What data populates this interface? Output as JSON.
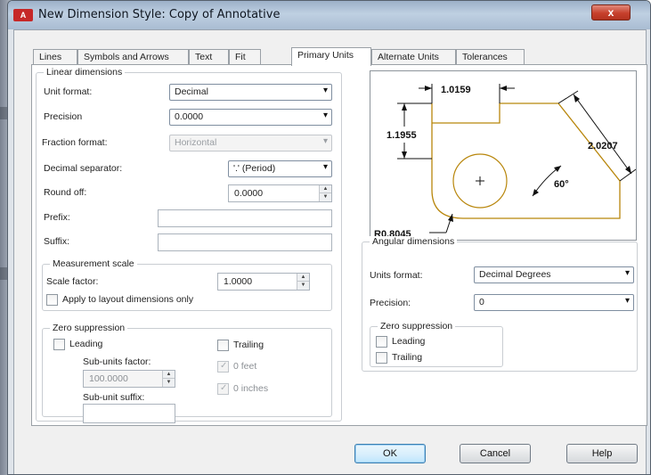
{
  "window": {
    "app_icon": "A",
    "title": "New Dimension Style: Copy of Annotative",
    "close_label": "x"
  },
  "tabs": [
    {
      "label": "Lines",
      "active": false
    },
    {
      "label": "Symbols and Arrows",
      "active": false
    },
    {
      "label": "Text",
      "active": false
    },
    {
      "label": "Fit",
      "active": false
    },
    {
      "label": "Primary Units",
      "active": true
    },
    {
      "label": "Alternate Units",
      "active": false
    },
    {
      "label": "Tolerances",
      "active": false
    }
  ],
  "linear": {
    "legend": "Linear dimensions",
    "unit_format": {
      "label": "Unit format:",
      "value": "Decimal"
    },
    "precision": {
      "label": "Precision",
      "value": "0.0000"
    },
    "fraction_format": {
      "label": "Fraction format:",
      "value": "Horizontal"
    },
    "decimal_separator": {
      "label": "Decimal separator:",
      "value": "'.' (Period)"
    },
    "round_off": {
      "label": "Round off:",
      "value": "0.0000"
    },
    "prefix": {
      "label": "Prefix:",
      "value": ""
    },
    "suffix": {
      "label": "Suffix:",
      "value": ""
    }
  },
  "measurement": {
    "legend": "Measurement scale",
    "scale_factor": {
      "label": "Scale factor:",
      "value": "1.0000"
    },
    "apply_layout": "Apply to layout dimensions only"
  },
  "zero_linear": {
    "legend": "Zero suppression",
    "leading": "Leading",
    "trailing": "Trailing",
    "sub_units_factor": {
      "label": "Sub-units factor:",
      "value": "100.0000"
    },
    "sub_unit_suffix": {
      "label": "Sub-unit suffix:",
      "value": ""
    },
    "zero_feet": "0 feet",
    "zero_inches": "0 inches"
  },
  "preview": {
    "dim_top": "1.0159",
    "dim_left": "1.1955",
    "dim_right": "2.0207",
    "angle": "60°",
    "radius": "R0.8045"
  },
  "angular": {
    "legend": "Angular dimensions",
    "units_format": {
      "label": "Units format:",
      "value": "Decimal Degrees"
    },
    "precision": {
      "label": "Precision:",
      "value": "0"
    },
    "zero_legend": "Zero suppression",
    "leading": "Leading",
    "trailing": "Trailing"
  },
  "buttons": {
    "ok": "OK",
    "cancel": "Cancel",
    "help": "Help"
  },
  "colors": {
    "accent": "#3c7fb1",
    "preview_outline": "#b8860b",
    "close": "#c7402c"
  }
}
